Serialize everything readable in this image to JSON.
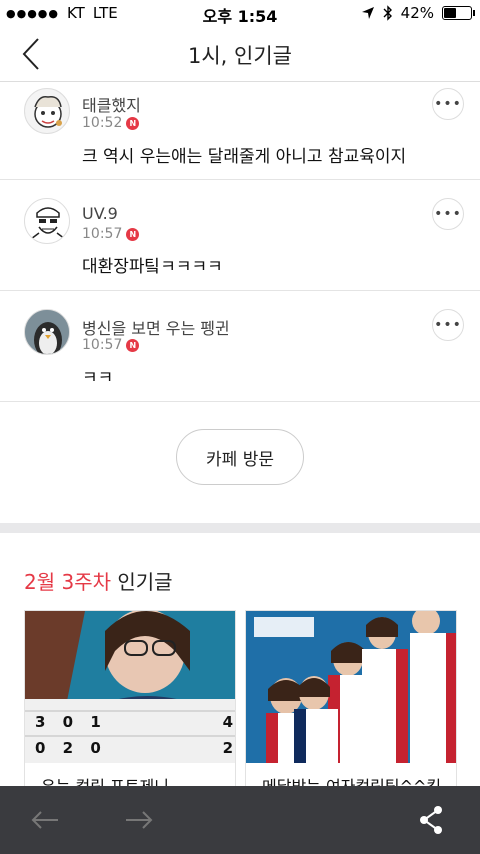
{
  "status_bar": {
    "carrier": "KT",
    "network": "LTE",
    "time": "오후 1:54",
    "battery": "42%",
    "battery_level": 0.42
  },
  "header": {
    "title": "1시, 인기글"
  },
  "comments": [
    {
      "name": "태클했지",
      "time": "10:52",
      "badge": "N",
      "text": "크 역시 우는애는 달래줄게 아니고 참교육이지"
    },
    {
      "name": "UV.9",
      "time": "10:57",
      "badge": "N",
      "text": "대환장파팈ㅋㅋㅋㅋ"
    },
    {
      "name": "병신을 보면 우는 펭귄",
      "time": "10:57",
      "badge": "N",
      "text": "ㅋㅋ"
    }
  ],
  "cafe_button": "카페 방문",
  "section": {
    "accent": "2월 3주차",
    "title": "인기글"
  },
  "cards": [
    {
      "title": "우는 컬링 포토제니",
      "score_top": "3 0 1",
      "score_bottom": "0 2 0",
      "score_right_top": "4",
      "score_right_bottom": "2"
    },
    {
      "title": "메달받는 여자컬링팀^^킥"
    }
  ],
  "colors": {
    "accent": "#e53946",
    "toolbar": "#3a3b3f"
  }
}
